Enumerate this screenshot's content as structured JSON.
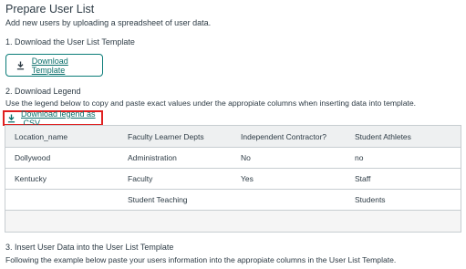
{
  "page": {
    "title": "Prepare User List",
    "subtitle": "Add new users by uploading a spreadsheet of user data."
  },
  "step1": {
    "heading": "1. Download the User List Template",
    "button_label": "Download Template",
    "button_icon": "download-icon"
  },
  "step2": {
    "heading": "2. Download Legend",
    "help": "Use the legend below to copy and paste exact values under the appropiate columns when inserting data into template.",
    "link_label": "Download legend as .CSV",
    "link_icon": "download-icon"
  },
  "legend_table": {
    "headers": [
      "Location_name",
      "Faculty Learner Depts",
      "Independent Contractor?",
      "Student Athletes"
    ],
    "rows": [
      [
        "Dollywood",
        "Administration",
        "No",
        "no"
      ],
      [
        "Kentucky",
        "Faculty",
        "Yes",
        "Staff"
      ],
      [
        "",
        "Student Teaching",
        "",
        "Students"
      ]
    ]
  },
  "step3": {
    "heading": "3. Insert User Data into the User List Template",
    "help": "Following the example below paste your users information into the appropiate columns in the User List Template."
  },
  "colors": {
    "accent": "#0a7c78",
    "highlight_border": "#e02020",
    "text": "#2d3b45",
    "border": "#c7cdd1"
  }
}
